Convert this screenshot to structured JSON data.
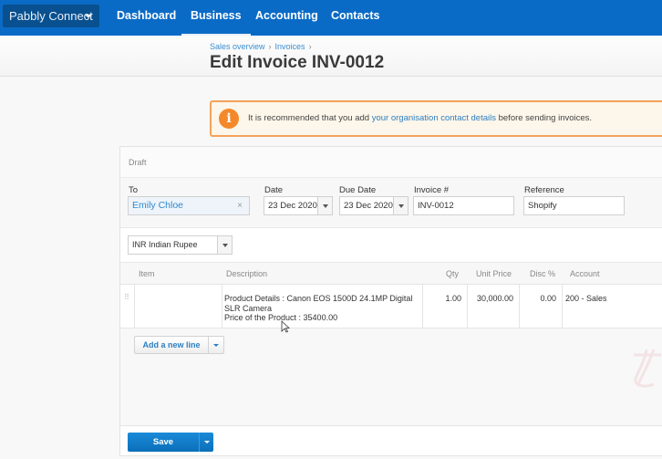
{
  "nav": {
    "org_name": "Pabbly Connect",
    "items": [
      {
        "label": "Dashboard"
      },
      {
        "label": "Business",
        "active": true
      },
      {
        "label": "Accounting"
      },
      {
        "label": "Contacts"
      }
    ],
    "brand_color": "#0a6bc6"
  },
  "header": {
    "breadcrumb": [
      "Sales overview",
      "Invoices"
    ],
    "breadcrumb_sep": "›",
    "title": "Edit Invoice INV-0012"
  },
  "alert": {
    "icon": "info-icon",
    "icon_glyph": "i",
    "text_before": "It is recommended that you add ",
    "link_text": "your organisation contact details",
    "text_after": " before sending invoices."
  },
  "invoice": {
    "status": "Draft",
    "to": {
      "label": "To",
      "value": "Emily Chloe",
      "clear_glyph": "×"
    },
    "date": {
      "label": "Date",
      "value": "23 Dec 2020"
    },
    "due_date": {
      "label": "Due Date",
      "value": "23 Dec 2020"
    },
    "invoice_number": {
      "label": "Invoice #",
      "value": "INV-0012"
    },
    "reference": {
      "label": "Reference",
      "value": "Shopify"
    },
    "currency": "INR Indian Rupee"
  },
  "table": {
    "columns": [
      "Item",
      "Description",
      "Qty",
      "Unit Price",
      "Disc %",
      "Account"
    ],
    "rows": [
      {
        "item": "",
        "description": [
          "Product Details : Canon EOS 1500D 24.1MP Digital",
          "SLR Camera",
          "Price of the Product : 35400.00"
        ],
        "qty": "1.00",
        "unit_price": "30,000.00",
        "disc": "0.00",
        "account": "200 - Sales"
      }
    ]
  },
  "actions": {
    "add_line": "Add a new line",
    "save": "Save"
  }
}
